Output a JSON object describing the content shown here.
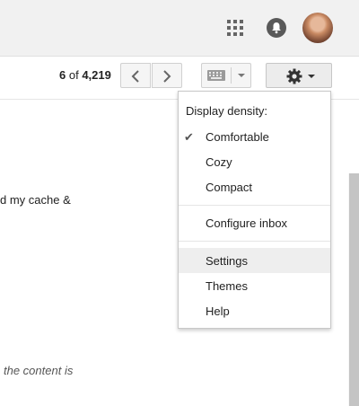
{
  "header": {
    "apps_icon": "apps-grid-icon",
    "notifications_icon": "bell-icon",
    "avatar_icon": "account-avatar"
  },
  "toolbar": {
    "count_current": "6",
    "count_of": "of",
    "count_total": "4,219",
    "prev_icon": "chevron-left-icon",
    "next_icon": "chevron-right-icon",
    "keyboard_icon": "keyboard-icon",
    "settings_icon": "gear-icon"
  },
  "content": {
    "line1": "d my cache &",
    "line2": "the content is"
  },
  "settings_menu": {
    "heading": "Display density:",
    "density_options": [
      {
        "label": "Comfortable",
        "checked": true
      },
      {
        "label": "Cozy",
        "checked": false
      },
      {
        "label": "Compact",
        "checked": false
      }
    ],
    "configure_inbox": "Configure inbox",
    "settings": "Settings",
    "themes": "Themes",
    "help": "Help",
    "check_glyph": "✔",
    "hovered_item": "Settings"
  }
}
